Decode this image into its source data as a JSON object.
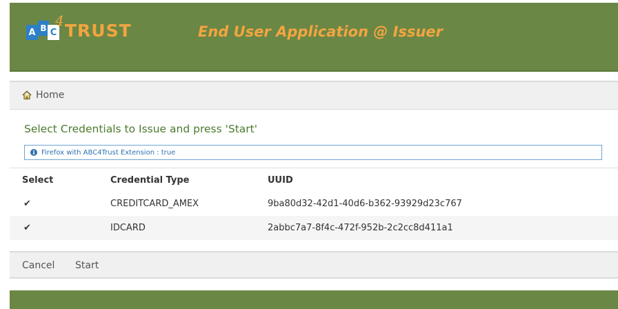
{
  "header": {
    "logo_letters": [
      "A",
      "B",
      "C",
      "4",
      "TRUST"
    ],
    "app_title": "End User Application @ Issuer"
  },
  "nav": {
    "home_label": "Home"
  },
  "page": {
    "heading": "Select Credentials to Issue and press 'Start'",
    "info_text": "Firefox with ABC4Trust Extension : true"
  },
  "table": {
    "columns": [
      "Select",
      "Credential Type",
      "UUID"
    ],
    "rows": [
      {
        "selected": "✔",
        "type": "CREDITCARD_AMEX",
        "uuid": "9ba80d32-42d1-40d6-b362-93929d23c767"
      },
      {
        "selected": "✔",
        "type": "IDCARD",
        "uuid": "2abbc7a7-8f4c-472f-952b-2c2cc8d411a1"
      }
    ]
  },
  "actions": {
    "cancel_label": "Cancel",
    "start_label": "Start"
  },
  "colors": {
    "brand_green": "#6b8745",
    "brand_orange": "#f2a540",
    "logo_blue": "#2d7fc6",
    "heading_green": "#4a7a2c",
    "info_blue": "#2f71b0"
  }
}
